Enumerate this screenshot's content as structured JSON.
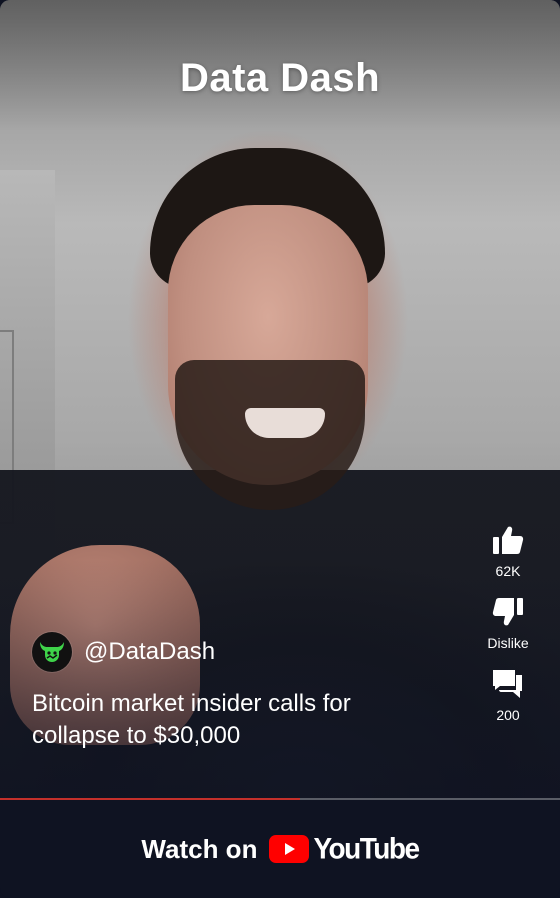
{
  "header": {
    "title": "Data Dash"
  },
  "actions": {
    "like": {
      "icon": "thumbs-up-icon",
      "label": "62K"
    },
    "dislike": {
      "icon": "thumbs-down-icon",
      "label": "Dislike"
    },
    "comments": {
      "icon": "comments-icon",
      "label": "200"
    }
  },
  "channel": {
    "handle": "@DataDash",
    "avatar": "bull-logo-avatar"
  },
  "video": {
    "caption": "Bitcoin market insider calls for collapse to $30,000",
    "progress": 0.535
  },
  "footer": {
    "watch_label": "Watch on",
    "brand": "YouTube"
  },
  "colors": {
    "accent": "#c4302b",
    "youtube_red": "#ff0000",
    "background": "#0f1322",
    "avatar_green": "#3fd44a"
  }
}
